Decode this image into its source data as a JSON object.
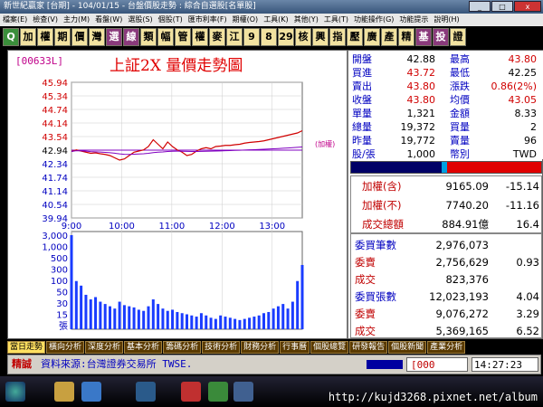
{
  "window": {
    "title": "新世紀贏家 [台期] - 104/01/15 - 台盤價股走勢 : 綜合自選股[名單股]"
  },
  "menu": [
    "檔案(E)",
    "檢查(V)",
    "主力(M)",
    "看盤(W)",
    "選股(S)",
    "個股(T)",
    "匯市利率(F)",
    "期權(O)",
    "工具(K)",
    "其他(Y)",
    "工具(T)",
    "功能操作(G)",
    "功能提示",
    "說明(H)"
  ],
  "toolbar": [
    "Q",
    "加",
    "權",
    "期",
    "價",
    "灣",
    "選",
    "線",
    "類",
    "幅",
    "管",
    "權",
    "麥",
    "江",
    "9",
    "8",
    "29",
    "核",
    "興",
    "指",
    "壓",
    "廣",
    "產",
    "精",
    "基",
    "投",
    "證"
  ],
  "header": {
    "code": "[00633L]",
    "title": "上証2X  量價走勢圖"
  },
  "colors": {
    "up": "#d00000",
    "down": "#0000c0",
    "price_line": "#d00000",
    "avg_line": "#8000c0"
  },
  "quote": {
    "rows": [
      {
        "l": "開盤",
        "v": "42.88",
        "l2": "最高",
        "v2": "43.80",
        "vc": "blk",
        "v2c": "red"
      },
      {
        "l": "買進",
        "v": "43.72",
        "l2": "最低",
        "v2": "42.25",
        "vc": "red",
        "v2c": "blk"
      },
      {
        "l": "賣出",
        "v": "43.80",
        "l2": "漲跌",
        "v2": "0.86(2%)",
        "vc": "red",
        "v2c": "red"
      },
      {
        "l": "收盤",
        "v": "43.80",
        "l2": "均價",
        "v2": "43.05",
        "vc": "red",
        "v2c": "red"
      },
      {
        "l": "單量",
        "v": "1,321",
        "l2": "金額",
        "v2": "8.33",
        "vc": "blk",
        "v2c": "blk"
      },
      {
        "l": "總量",
        "v": "19,372",
        "l2": "買量",
        "v2": "2",
        "vc": "blk",
        "v2c": "blk"
      },
      {
        "l": "昨量",
        "v": "19,772",
        "l2": "賣量",
        "v2": "96",
        "vc": "blk",
        "v2c": "blk"
      },
      {
        "l": "股/張",
        "v": "1,000",
        "l2": "幣別",
        "v2": "TWD",
        "vc": "blk",
        "v2c": "blk"
      }
    ]
  },
  "index": {
    "rows": [
      {
        "l": "加權(含)",
        "v": "9165.09",
        "v2": "-15.14"
      },
      {
        "l": "加權(不)",
        "v": "7740.20",
        "v2": "-11.16"
      },
      {
        "l": "成交總額",
        "v": "884.91億",
        "v2": "16.4"
      }
    ]
  },
  "orders": {
    "rows": [
      {
        "l": "委買筆數",
        "v": "2,976,073",
        "v2": ""
      },
      {
        "l": "委賣",
        "v": "2,756,629",
        "v2": "0.93"
      },
      {
        "l": "成交",
        "v": "823,376",
        "v2": ""
      },
      {
        "l": "委買張數",
        "v": "12,023,193",
        "v2": "4.04"
      },
      {
        "l": "委賣",
        "v": "9,076,272",
        "v2": "3.29"
      },
      {
        "l": "成交",
        "v": "5,369,165",
        "v2": "6.52"
      }
    ]
  },
  "tabs": [
    "當日走勢",
    "橫向分析",
    "深度分析",
    "基本分析",
    "籌碼分析",
    "技術分析",
    "財務分析",
    "行事曆",
    "個股總覽",
    "研發報告",
    "個股新聞",
    "產業分析"
  ],
  "status": {
    "label": "精誠",
    "source": "資料來源:台灣證券交易所 TWSE.",
    "field": "[000",
    "time": "14:27:23"
  },
  "watermark": "http://kujd3268.pixnet.net/album",
  "chart_data": {
    "type": "line",
    "title": "上証2X  量價走勢圖",
    "x_ticks": [
      "9:00",
      "10:00",
      "11:00",
      "12:00",
      "13:00"
    ],
    "price_ticks": [
      "45.94",
      "45.34",
      "44.74",
      "44.14",
      "43.54",
      "42.94",
      "42.34",
      "41.74",
      "41.14",
      "40.54",
      "39.94"
    ],
    "volume_ticks": [
      "3,000",
      "1,000",
      "500",
      "300",
      "100",
      "50",
      "30",
      "15",
      "張"
    ],
    "ylim": [
      39.94,
      45.94
    ],
    "ref_price": 42.94,
    "ref_label": "(加權)",
    "price": [
      42.88,
      42.95,
      42.9,
      42.85,
      42.8,
      42.82,
      42.78,
      42.75,
      42.7,
      42.6,
      42.5,
      42.55,
      42.7,
      42.85,
      42.9,
      42.95,
      43.1,
      43.4,
      43.2,
      43.0,
      43.3,
      43.1,
      42.95,
      42.85,
      42.7,
      42.75,
      42.9,
      43.0,
      43.05,
      43.0,
      43.1,
      43.12,
      43.15,
      43.15,
      43.18,
      43.2,
      43.25,
      43.28,
      43.3,
      43.32,
      43.35,
      43.4,
      43.45,
      43.5,
      43.55,
      43.6,
      43.65,
      43.7,
      43.8
    ],
    "volume": [
      820,
      420,
      380,
      300,
      260,
      280,
      240,
      220,
      200,
      180,
      240,
      210,
      200,
      190,
      170,
      160,
      200,
      260,
      220,
      180,
      160,
      170,
      150,
      140,
      130,
      120,
      110,
      140,
      120,
      100,
      90,
      120,
      110,
      100,
      90,
      80,
      90,
      100,
      110,
      120,
      140,
      150,
      180,
      200,
      220,
      180,
      240,
      420,
      560
    ]
  }
}
